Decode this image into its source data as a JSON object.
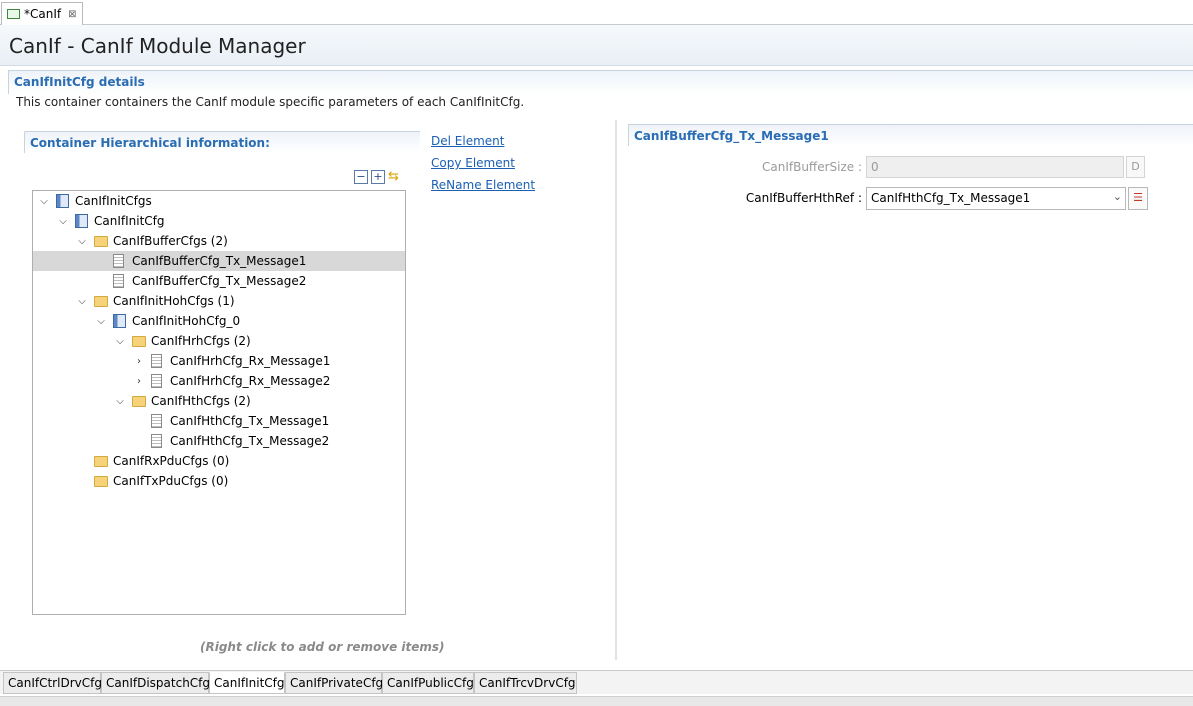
{
  "editor_tab": {
    "title": "*CanIf",
    "close": "⊠"
  },
  "header": {
    "title": "CanIf - CanIf Module Manager"
  },
  "details": {
    "title": "CanIfInitCfg details",
    "description": "This container containers the CanIf module specific parameters of each CanIfInitCfg."
  },
  "hierarchy": {
    "title": "Container Hierarchical information:",
    "tree": [
      {
        "label": "CanIfInitCfgs",
        "icon": "container-icon",
        "expand": "open"
      },
      {
        "label": "CanIfInitCfg",
        "icon": "container-icon",
        "expand": "open"
      },
      {
        "label": "CanIfBufferCfgs (2)",
        "icon": "folder-icon",
        "expand": "open"
      },
      {
        "label": "CanIfBufferCfg_Tx_Message1",
        "icon": "page-icon",
        "expand": "none",
        "selected": true
      },
      {
        "label": "CanIfBufferCfg_Tx_Message2",
        "icon": "page-icon",
        "expand": "none"
      },
      {
        "label": "CanIfInitHohCfgs (1)",
        "icon": "folder-icon",
        "expand": "open"
      },
      {
        "label": "CanIfInitHohCfg_0",
        "icon": "container-icon",
        "expand": "open"
      },
      {
        "label": "CanIfHrhCfgs (2)",
        "icon": "folder-icon",
        "expand": "open"
      },
      {
        "label": "CanIfHrhCfg_Rx_Message1",
        "icon": "page-icon",
        "expand": "closed"
      },
      {
        "label": "CanIfHrhCfg_Rx_Message2",
        "icon": "page-icon",
        "expand": "closed"
      },
      {
        "label": "CanIfHthCfgs (2)",
        "icon": "folder-icon",
        "expand": "open"
      },
      {
        "label": "CanIfHthCfg_Tx_Message1",
        "icon": "page-icon",
        "expand": "none"
      },
      {
        "label": "CanIfHthCfg_Tx_Message2",
        "icon": "page-icon",
        "expand": "none"
      },
      {
        "label": "CanIfRxPduCfgs (0)",
        "icon": "folder-icon",
        "expand": "none"
      },
      {
        "label": "CanIfTxPduCfgs (0)",
        "icon": "folder-icon",
        "expand": "none"
      }
    ],
    "note": "(Right click to add or remove items)"
  },
  "actions": {
    "del": "Del Element",
    "copy": "Copy Element",
    "rename": "ReName Element"
  },
  "buffer_panel": {
    "title": "CanIfBufferCfg_Tx_Message1",
    "size_label": "CanIfBufferSize :",
    "size_value": "0",
    "size_suffix": "D",
    "hth_label": "CanIfBufferHthRef :",
    "hth_value": "CanIfHthCfg_Tx_Message1"
  },
  "bottom_tabs": [
    {
      "label": "CanIfCtrlDrvCfg"
    },
    {
      "label": "CanIfDispatchCfg"
    },
    {
      "label": "CanIfInitCfg",
      "active": true
    },
    {
      "label": "CanIfPrivateCfg"
    },
    {
      "label": "CanIfPublicCfg"
    },
    {
      "label": "CanIfTrcvDrvCfg"
    }
  ]
}
